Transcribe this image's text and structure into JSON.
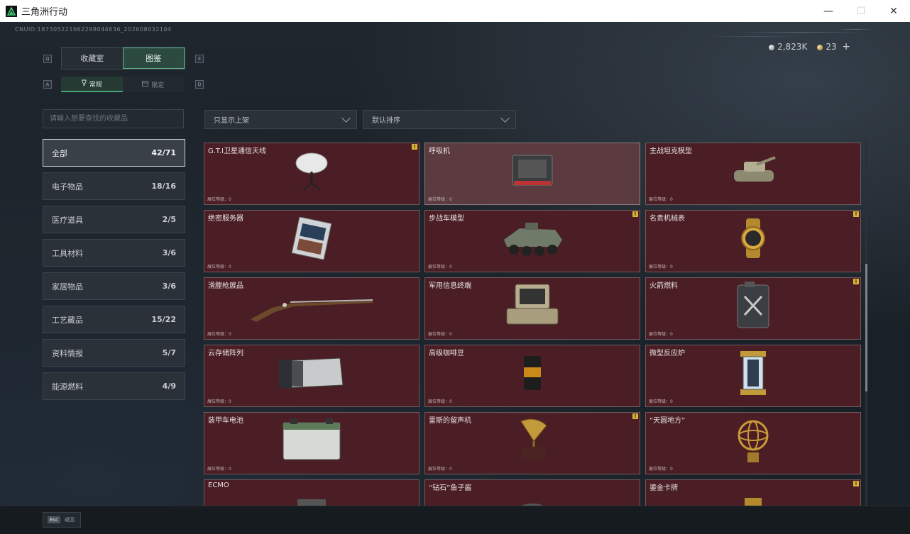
{
  "window": {
    "title": "三角洲行动",
    "minimize": "—",
    "maximize": "☐",
    "close": "✕"
  },
  "uid": "CNUID:187305221662298044636_202608032104",
  "currency": {
    "silver": "2,823K",
    "gold": "23",
    "add": "+"
  },
  "tabs": {
    "key_left": "Q",
    "key_right": "E",
    "items": [
      {
        "label": "收藏室",
        "active": false
      },
      {
        "label": "图鉴",
        "active": true
      }
    ]
  },
  "subtabs": {
    "key_left": "A",
    "key_right": "D",
    "items": [
      {
        "label": "常规",
        "icon": "trophy-icon",
        "active": true
      },
      {
        "label": "限定",
        "icon": "box-icon",
        "active": false
      }
    ]
  },
  "search": {
    "placeholder": "请输入想要查找的收藏品",
    "value": ""
  },
  "categories": [
    {
      "label": "全部",
      "count": "42/71",
      "active": true
    },
    {
      "label": "电子物品",
      "count": "18/16",
      "active": false
    },
    {
      "label": "医疗道具",
      "count": "2/5",
      "active": false
    },
    {
      "label": "工具材料",
      "count": "3/6",
      "active": false
    },
    {
      "label": "家居物品",
      "count": "3/6",
      "active": false
    },
    {
      "label": "工艺藏品",
      "count": "15/22",
      "active": false
    },
    {
      "label": "资料情报",
      "count": "5/7",
      "active": false
    },
    {
      "label": "能源燃料",
      "count": "4/9",
      "active": false
    }
  ],
  "filters": {
    "shelf": "只显示上架",
    "sort": "默认排序"
  },
  "level_label": "展位等级：0",
  "items": [
    {
      "name": "G.T.I卫星通信天线",
      "badge": "!",
      "icon": "satellite-dish-icon",
      "selected": false
    },
    {
      "name": "呼吸机",
      "badge": "",
      "icon": "ventilator-icon",
      "selected": true
    },
    {
      "name": "主战坦克模型",
      "badge": "",
      "icon": "tank-model-icon",
      "selected": false
    },
    {
      "name": "绝密服务器",
      "badge": "",
      "icon": "server-icon",
      "selected": false
    },
    {
      "name": "步战车模型",
      "badge": "!",
      "icon": "ifv-model-icon",
      "selected": false
    },
    {
      "name": "名贵机械表",
      "badge": "!",
      "icon": "watch-icon",
      "selected": false
    },
    {
      "name": "滑膛枪展品",
      "badge": "",
      "icon": "musket-icon",
      "selected": false
    },
    {
      "name": "军用信息终端",
      "badge": "",
      "icon": "terminal-icon",
      "selected": false
    },
    {
      "name": "火箭燃料",
      "badge": "!",
      "icon": "fuel-canister-icon",
      "selected": false
    },
    {
      "name": "云存储阵列",
      "badge": "",
      "icon": "storage-array-icon",
      "selected": false
    },
    {
      "name": "高级咖啡豆",
      "badge": "",
      "icon": "coffee-bag-icon",
      "selected": false
    },
    {
      "name": "微型反应炉",
      "badge": "",
      "icon": "reactor-icon",
      "selected": false
    },
    {
      "name": "装甲车电池",
      "badge": "",
      "icon": "battery-icon",
      "selected": false
    },
    {
      "name": "雷斯的留声机",
      "badge": "!",
      "icon": "gramophone-icon",
      "selected": false
    },
    {
      "name": "“天圆地方”",
      "badge": "",
      "icon": "armillary-sphere-icon",
      "selected": false
    },
    {
      "name": "ECMO",
      "badge": "",
      "icon": "ecmo-icon",
      "selected": false
    },
    {
      "name": "“钻石”鱼子酱",
      "badge": "",
      "icon": "caviar-icon",
      "selected": false
    },
    {
      "name": "鎏金卡牌",
      "badge": "!",
      "icon": "card-icon",
      "selected": false
    }
  ],
  "footer": {
    "esc_key": "Esc",
    "esc_label": "返回"
  }
}
